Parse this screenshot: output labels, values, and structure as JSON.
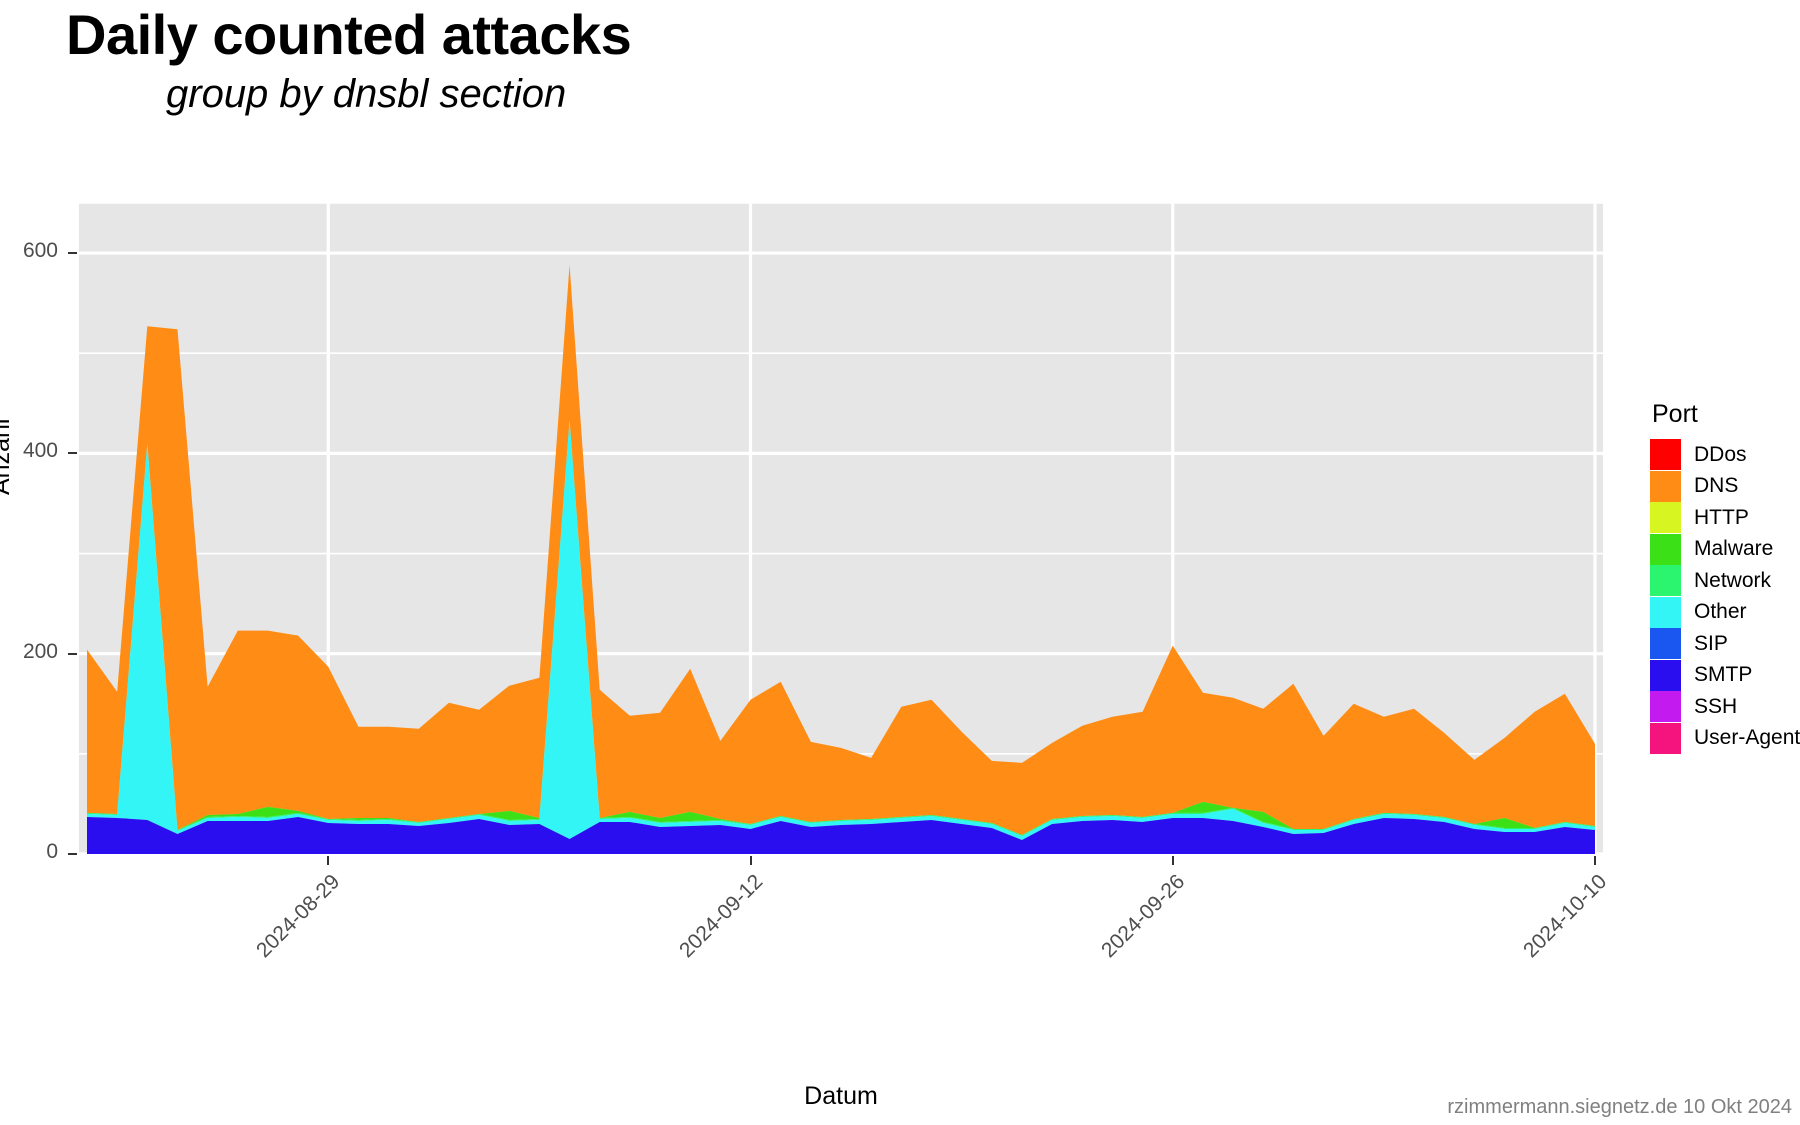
{
  "header": {
    "title": "Daily counted attacks",
    "subtitle": "group by dnsbl section"
  },
  "caption": "rzimmermann.siegnetz.de 10 Okt 2024",
  "legend": {
    "title": "Port",
    "items": [
      {
        "label": "DDos",
        "color": "#ff0000"
      },
      {
        "label": "DNS",
        "color": "#ff8c14"
      },
      {
        "label": "HTTP",
        "color": "#d6f521"
      },
      {
        "label": "Malware",
        "color": "#3ce016"
      },
      {
        "label": "Network",
        "color": "#2bf56e"
      },
      {
        "label": "Other",
        "color": "#33f5f5"
      },
      {
        "label": "SIP",
        "color": "#1a56f0"
      },
      {
        "label": "SMTP",
        "color": "#2a0ef0"
      },
      {
        "label": "SSH",
        "color": "#c31af0"
      },
      {
        "label": "User-Agent",
        "color": "#f5147d"
      }
    ]
  },
  "chart_data": {
    "type": "area",
    "stacked": true,
    "title": "Daily counted attacks",
    "subtitle": "group by dnsbl section",
    "xlabel": "Datum",
    "ylabel": "Anzahl",
    "ylim": [
      0,
      650
    ],
    "yticks": [
      0,
      200,
      400,
      600
    ],
    "ytick_labels": [
      "0",
      "200",
      "400",
      "600"
    ],
    "grid": true,
    "legend_position": "right",
    "xticks": [
      "2024-08-29",
      "2024-09-12",
      "2024-09-26",
      "2024-10-10"
    ],
    "xtick_index": [
      8,
      22,
      36,
      50
    ],
    "x": [
      "2024-08-21",
      "2024-08-22",
      "2024-08-23",
      "2024-08-24",
      "2024-08-25",
      "2024-08-26",
      "2024-08-27",
      "2024-08-28",
      "2024-08-29",
      "2024-08-30",
      "2024-08-31",
      "2024-09-01",
      "2024-09-02",
      "2024-09-03",
      "2024-09-04",
      "2024-09-05",
      "2024-09-06",
      "2024-09-07",
      "2024-09-08",
      "2024-09-09",
      "2024-09-10",
      "2024-09-11",
      "2024-09-12",
      "2024-09-13",
      "2024-09-14",
      "2024-09-15",
      "2024-09-16",
      "2024-09-17",
      "2024-09-18",
      "2024-09-19",
      "2024-09-20",
      "2024-09-21",
      "2024-09-22",
      "2024-09-23",
      "2024-09-24",
      "2024-09-25",
      "2024-09-26",
      "2024-09-27",
      "2024-09-28",
      "2024-09-29",
      "2024-09-30",
      "2024-10-01",
      "2024-10-02",
      "2024-10-03",
      "2024-10-04",
      "2024-10-05",
      "2024-10-06",
      "2024-10-07",
      "2024-10-08",
      "2024-10-09",
      "2024-10-10"
    ],
    "series": [
      {
        "name": "SMTP",
        "color": "#2a0ef0",
        "values": [
          37,
          36,
          34,
          20,
          33,
          33,
          33,
          37,
          31,
          30,
          30,
          28,
          31,
          35,
          29,
          30,
          15,
          32,
          32,
          27,
          28,
          29,
          25,
          33,
          27,
          29,
          30,
          32,
          34,
          30,
          26,
          14,
          30,
          33,
          34,
          32,
          36,
          36,
          33,
          27,
          20,
          21,
          30,
          36,
          35,
          32,
          25,
          22,
          22,
          27,
          24
        ]
      },
      {
        "name": "SIP",
        "color": "#1a56f0",
        "values": [
          0,
          0,
          0,
          0,
          0,
          0,
          0,
          0,
          0,
          0,
          0,
          0,
          0,
          0,
          0,
          0,
          0,
          0,
          0,
          0,
          0,
          0,
          0,
          0,
          0,
          0,
          0,
          0,
          0,
          0,
          0,
          0,
          0,
          0,
          0,
          0,
          0,
          0,
          0,
          0,
          0,
          0,
          0,
          0,
          0,
          0,
          0,
          0,
          0,
          0,
          0
        ]
      },
      {
        "name": "Other",
        "color": "#33f5f5",
        "values": [
          3,
          3,
          375,
          3,
          3,
          4,
          3,
          3,
          3,
          3,
          4,
          3,
          4,
          4,
          4,
          4,
          417,
          3,
          4,
          4,
          4,
          4,
          4,
          4,
          4,
          4,
          4,
          4,
          4,
          4,
          4,
          4,
          4,
          4,
          4,
          4,
          4,
          4,
          12,
          4,
          4,
          3,
          4,
          4,
          4,
          4,
          4,
          3,
          3,
          4,
          3
        ]
      },
      {
        "name": "Network",
        "color": "#2bf56e",
        "values": [
          1,
          1,
          1,
          1,
          1,
          1,
          1,
          1,
          1,
          1,
          1,
          1,
          1,
          1,
          1,
          1,
          1,
          1,
          1,
          1,
          1,
          1,
          1,
          1,
          1,
          1,
          1,
          1,
          1,
          1,
          1,
          1,
          1,
          1,
          1,
          1,
          1,
          1,
          1,
          1,
          1,
          1,
          1,
          1,
          1,
          1,
          1,
          1,
          1,
          1,
          1
        ]
      },
      {
        "name": "Malware",
        "color": "#3ce016",
        "values": [
          0,
          0,
          0,
          0,
          2,
          2,
          10,
          2,
          0,
          2,
          1,
          0,
          0,
          0,
          9,
          1,
          0,
          0,
          5,
          4,
          9,
          1,
          0,
          0,
          0,
          0,
          0,
          0,
          0,
          0,
          0,
          0,
          0,
          0,
          0,
          0,
          0,
          11,
          0,
          10,
          0,
          0,
          0,
          0,
          0,
          0,
          0,
          10,
          0,
          0,
          0
        ]
      },
      {
        "name": "HTTP",
        "color": "#d6f521",
        "values": [
          0,
          0,
          0,
          0,
          0,
          0,
          0,
          0,
          0,
          0,
          0,
          0,
          0,
          0,
          0,
          0,
          0,
          0,
          0,
          0,
          0,
          0,
          0,
          0,
          0,
          0,
          0,
          0,
          0,
          0,
          0,
          0,
          0,
          0,
          0,
          0,
          0,
          0,
          0,
          0,
          0,
          0,
          0,
          0,
          0,
          0,
          0,
          0,
          0,
          0,
          0
        ]
      },
      {
        "name": "DNS",
        "color": "#ff8c14",
        "values": [
          163,
          122,
          117,
          500,
          128,
          183,
          176,
          175,
          152,
          91,
          91,
          93,
          115,
          104,
          125,
          140,
          155,
          128,
          96,
          105,
          143,
          78,
          124,
          134,
          80,
          72,
          61,
          110,
          115,
          87,
          62,
          72,
          76,
          90,
          98,
          105,
          167,
          109,
          110,
          103,
          145,
          93,
          115,
          96,
          105,
          84,
          64,
          80,
          116,
          128,
          82
        ]
      },
      {
        "name": "DDos",
        "color": "#ff0000",
        "values": [
          0,
          0,
          0,
          0,
          0,
          0,
          0,
          0,
          0,
          0,
          0,
          0,
          0,
          0,
          0,
          0,
          0,
          0,
          0,
          0,
          0,
          0,
          0,
          0,
          0,
          0,
          0,
          0,
          0,
          0,
          0,
          0,
          0,
          0,
          0,
          0,
          0,
          0,
          0,
          0,
          0,
          0,
          0,
          0,
          0,
          0,
          0,
          0,
          0,
          0,
          0
        ]
      },
      {
        "name": "SSH",
        "color": "#c31af0",
        "values": [
          0,
          0,
          0,
          0,
          0,
          0,
          0,
          0,
          0,
          0,
          0,
          0,
          0,
          0,
          0,
          0,
          0,
          0,
          0,
          0,
          0,
          0,
          0,
          0,
          0,
          0,
          0,
          0,
          0,
          0,
          0,
          0,
          0,
          0,
          0,
          0,
          0,
          0,
          0,
          0,
          0,
          0,
          0,
          0,
          0,
          0,
          0,
          0,
          0,
          0,
          0
        ]
      },
      {
        "name": "User-Agent",
        "color": "#f5147d",
        "values": [
          0,
          0,
          0,
          0,
          0,
          0,
          0,
          0,
          0,
          0,
          0,
          0,
          0,
          0,
          0,
          0,
          0,
          0,
          0,
          0,
          0,
          0,
          0,
          0,
          0,
          0,
          0,
          0,
          0,
          0,
          0,
          0,
          0,
          0,
          0,
          0,
          0,
          0,
          0,
          0,
          0,
          0,
          0,
          0,
          0,
          0,
          0,
          0,
          0,
          0,
          0
        ]
      }
    ]
  }
}
